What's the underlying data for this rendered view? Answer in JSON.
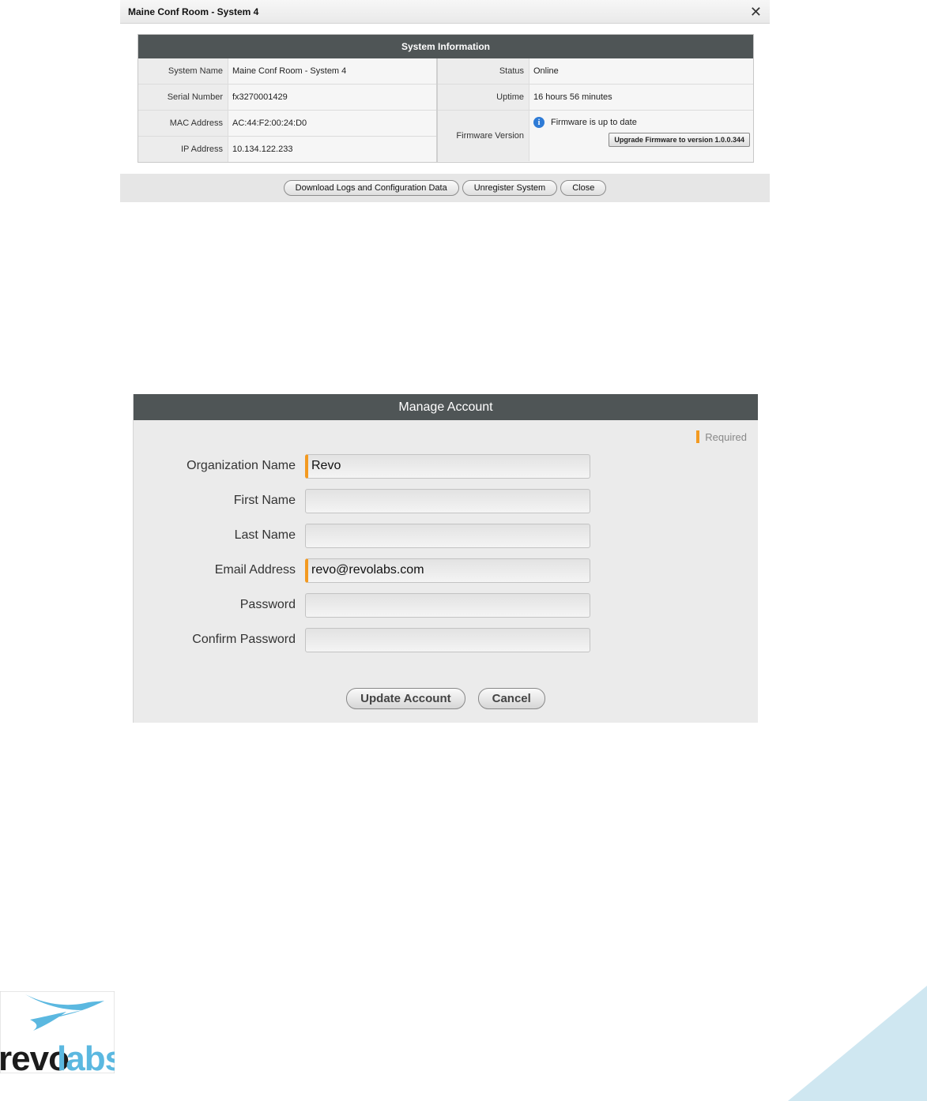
{
  "system_dialog": {
    "title": "Maine Conf Room - System 4",
    "close_glyph": "✕",
    "panel_header": "System Information",
    "left_rows": [
      {
        "label": "System Name",
        "value": "Maine Conf Room - System 4"
      },
      {
        "label": "Serial Number",
        "value": "fx3270001429"
      },
      {
        "label": "MAC Address",
        "value": "AC:44:F2:00:24:D0"
      },
      {
        "label": "IP Address",
        "value": "10.134.122.233"
      }
    ],
    "right_rows": [
      {
        "label": "Status",
        "value": "Online"
      },
      {
        "label": "Uptime",
        "value": "16 hours 56 minutes"
      },
      {
        "label": "Firmware Version",
        "value": "Firmware is up to date",
        "icon": "info-icon"
      }
    ],
    "upgrade_button": "Upgrade Firmware to version 1.0.0.344",
    "footer_buttons": {
      "download": "Download Logs and Configuration Data",
      "unregister": "Unregister System",
      "close": "Close"
    }
  },
  "manage_account": {
    "header": "Manage Account",
    "required_label": "Required",
    "fields": [
      {
        "label": "Organization Name",
        "value": "Revo",
        "required": true
      },
      {
        "label": "First Name",
        "value": "",
        "required": false
      },
      {
        "label": "Last Name",
        "value": "",
        "required": false
      },
      {
        "label": "Email Address",
        "value": "revo@revolabs.com",
        "required": true
      },
      {
        "label": "Password",
        "value": "",
        "required": false
      },
      {
        "label": "Confirm Password",
        "value": "",
        "required": false
      }
    ],
    "buttons": {
      "update": "Update Account",
      "cancel": "Cancel"
    }
  },
  "brand": {
    "logo_text": "revolabs",
    "logo_color": "#5bb8e0",
    "accent_required": "#f39a21",
    "header_bg": "#4f5556"
  }
}
